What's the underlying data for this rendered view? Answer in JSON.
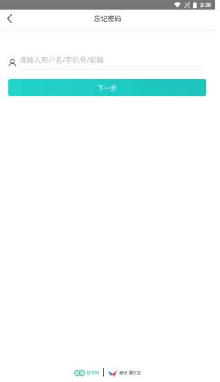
{
  "status_bar": {
    "time": "3:38"
  },
  "header": {
    "title": "忘记密码"
  },
  "form": {
    "username_placeholder": "请输入用户名/手机号/邮箱",
    "username_value": "",
    "next_label": "下一步"
  },
  "footer": {
    "brand1_text": "智学网",
    "brand2_name": "畅言",
    "brand2_suffix": "通行证"
  },
  "colors": {
    "accent": "#21d4c8",
    "status_bar": "#757575",
    "brand_green": "#1fbfae"
  },
  "icons": [
    "wifi-icon",
    "signal-icon",
    "battery-icon",
    "back-arrow-icon",
    "user-icon",
    "zhixue-logo-icon",
    "changyan-logo-icon"
  ]
}
